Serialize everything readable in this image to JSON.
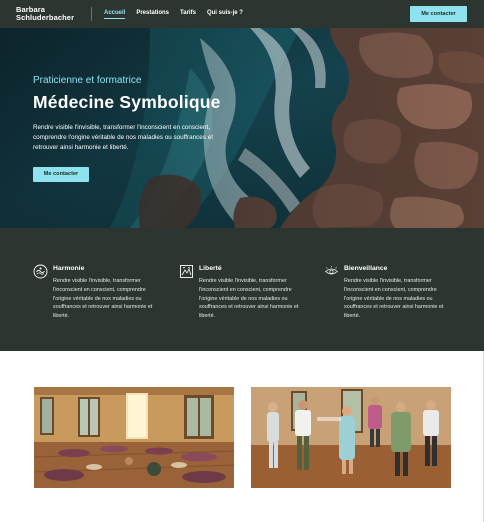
{
  "header": {
    "logo_line1": "Barbara",
    "logo_line2": "Schluderbacher",
    "nav": [
      {
        "label": "Accueil",
        "active": true
      },
      {
        "label": "Prestations",
        "active": false
      },
      {
        "label": "Tarifs",
        "active": false
      },
      {
        "label": "Qui suis-je ?",
        "active": false
      }
    ],
    "cta_label": "Me contacter"
  },
  "hero": {
    "eyebrow": "Praticienne et formatrice",
    "title": "Médecine Symbolique",
    "description": "Rendre visible l'invisible, transformer l'inconscient en conscient, comprendre l'origine véritable de nos maladies ou souffrances et retrouver ainsi harmonie et liberté.",
    "cta_label": "Me contacter"
  },
  "features": [
    {
      "icon": "harmony-icon",
      "title": "Harmonie",
      "text": "Rendre visible l'invisible, transformer l'inconscient en conscient, comprendre l'origine véritable de nos maladies ou souffrances et retrouver ainsi harmonie et liberté."
    },
    {
      "icon": "freedom-icon",
      "title": "Liberté",
      "text": "Rendre visible l'invisible, transformer l'inconscient en conscient, comprendre l'origine véritable de nos maladies ou souffrances et retrouver ainsi harmonie et liberté."
    },
    {
      "icon": "kindness-icon",
      "title": "Bienveillance",
      "text": "Rendre visible l'invisible, transformer l'inconscient en conscient, comprendre l'origine véritable de nos maladies ou souffrances et retrouver ainsi harmonie et liberté."
    }
  ],
  "colors": {
    "dark": "#2c3530",
    "accent": "#8fe3ee",
    "white": "#ffffff"
  }
}
